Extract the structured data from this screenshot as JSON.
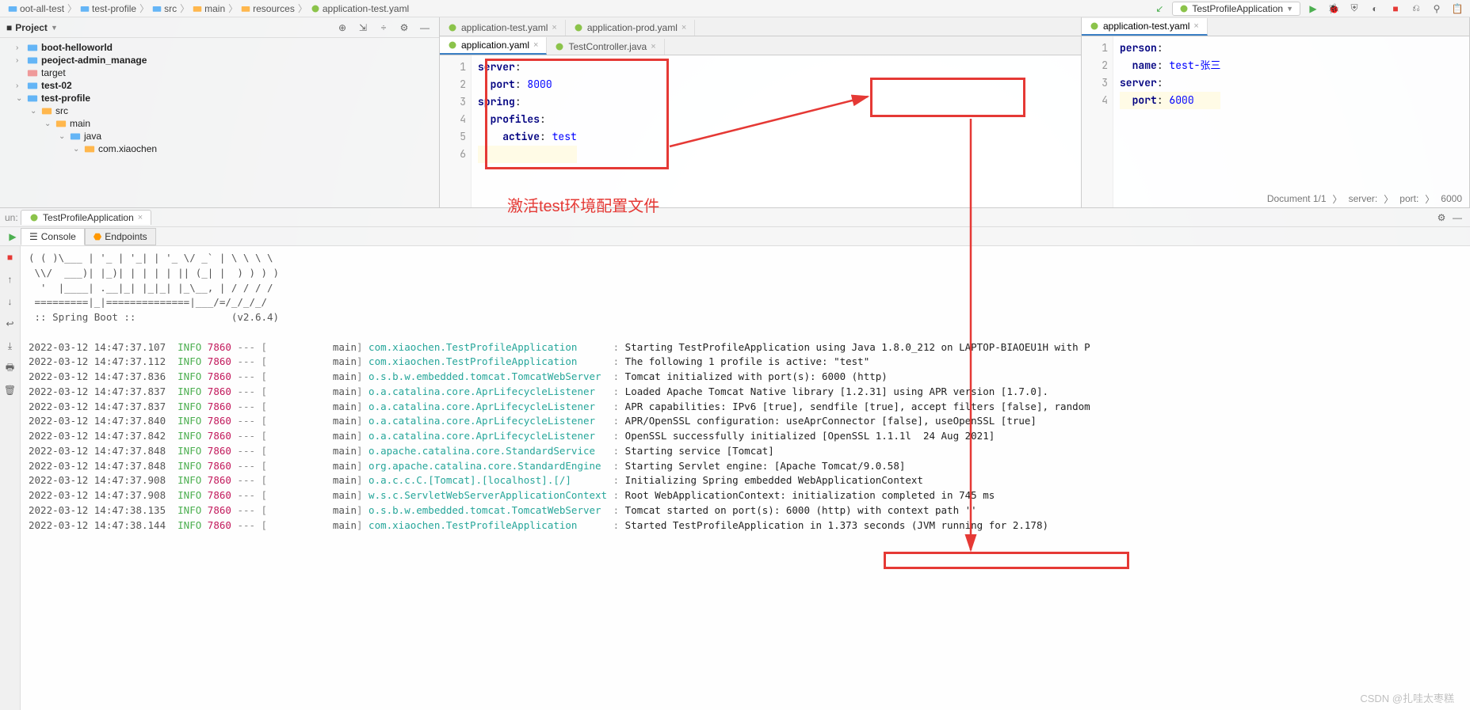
{
  "breadcrumb": [
    "oot-all-test",
    "test-profile",
    "src",
    "main",
    "resources",
    "application-test.yaml"
  ],
  "run_config": "TestProfileApplication",
  "project_panel_title": "Project",
  "tree": {
    "n0": "boot-helloworld",
    "n1": "peoject-admin_manage",
    "n2": "target",
    "n3": "test-02",
    "n4": "test-profile",
    "n5": "src",
    "n6": "main",
    "n7": "java",
    "n8": "com.xiaochen"
  },
  "tabs_left_top": [
    {
      "label": "application-test.yaml",
      "active": false
    },
    {
      "label": "application-prod.yaml",
      "active": false
    }
  ],
  "tabs_left_bottom": [
    {
      "label": "application.yaml",
      "active": true
    },
    {
      "label": "TestController.java",
      "active": false
    }
  ],
  "tabs_right_top": [
    {
      "label": "application-test.yaml",
      "active": true
    }
  ],
  "editor_left": {
    "lines": [
      {
        "n": "1",
        "kw": "server",
        "sep": ":",
        "val": ""
      },
      {
        "n": "2",
        "kw": "  port",
        "sep": ": ",
        "val": "8000"
      },
      {
        "n": "3",
        "kw": "spring",
        "sep": ":",
        "val": ""
      },
      {
        "n": "4",
        "kw": "  profiles",
        "sep": ":",
        "val": ""
      },
      {
        "n": "5",
        "kw": "    active",
        "sep": ": ",
        "val": "test"
      },
      {
        "n": "6",
        "kw": "",
        "sep": "",
        "val": ""
      }
    ]
  },
  "editor_right": {
    "lines": [
      {
        "n": "1",
        "kw": "person",
        "sep": ":",
        "val": ""
      },
      {
        "n": "2",
        "kw": "  name",
        "sep": ": ",
        "val": "test-张三"
      },
      {
        "n": "3",
        "kw": "server",
        "sep": ":",
        "val": ""
      },
      {
        "n": "4",
        "kw": "  port",
        "sep": ": ",
        "val": "6000"
      }
    ]
  },
  "annotation": "激活test环境配置文件",
  "status_right": [
    "Document 1/1",
    "server:",
    "port:",
    "6000"
  ],
  "run_label_prefix": "un:",
  "run_tab": "TestProfileApplication",
  "sub_tabs": [
    "Console",
    "Endpoints"
  ],
  "banner": [
    "( ( )\\___ | '_ | '_| | '_ \\/ _` | \\ \\ \\ \\",
    " \\\\/  ___)| |_)| | | | | || (_| |  ) ) ) )",
    "  '  |____| .__|_| |_|_| |_\\__, | / / / /",
    " =========|_|==============|___/=/_/_/_/",
    " :: Spring Boot ::                (v2.6.4)"
  ],
  "logs": [
    {
      "ts": "2022-03-12 14:47:37.107",
      "lvl": "INFO",
      "pid": "7860",
      "thread": "main",
      "logger": "com.xiaochen.TestProfileApplication",
      "msg": "Starting TestProfileApplication using Java 1.8.0_212 on LAPTOP-BIAOEU1H with P"
    },
    {
      "ts": "2022-03-12 14:47:37.112",
      "lvl": "INFO",
      "pid": "7860",
      "thread": "main",
      "logger": "com.xiaochen.TestProfileApplication",
      "msg": "The following 1 profile is active: \"test\""
    },
    {
      "ts": "2022-03-12 14:47:37.836",
      "lvl": "INFO",
      "pid": "7860",
      "thread": "main",
      "logger": "o.s.b.w.embedded.tomcat.TomcatWebServer",
      "msg": "Tomcat initialized with port(s): 6000 (http)"
    },
    {
      "ts": "2022-03-12 14:47:37.837",
      "lvl": "INFO",
      "pid": "7860",
      "thread": "main",
      "logger": "o.a.catalina.core.AprLifecycleListener",
      "msg": "Loaded Apache Tomcat Native library [1.2.31] using APR version [1.7.0]."
    },
    {
      "ts": "2022-03-12 14:47:37.837",
      "lvl": "INFO",
      "pid": "7860",
      "thread": "main",
      "logger": "o.a.catalina.core.AprLifecycleListener",
      "msg": "APR capabilities: IPv6 [true], sendfile [true], accept filters [false], random"
    },
    {
      "ts": "2022-03-12 14:47:37.840",
      "lvl": "INFO",
      "pid": "7860",
      "thread": "main",
      "logger": "o.a.catalina.core.AprLifecycleListener",
      "msg": "APR/OpenSSL configuration: useAprConnector [false], useOpenSSL [true]"
    },
    {
      "ts": "2022-03-12 14:47:37.842",
      "lvl": "INFO",
      "pid": "7860",
      "thread": "main",
      "logger": "o.a.catalina.core.AprLifecycleListener",
      "msg": "OpenSSL successfully initialized [OpenSSL 1.1.1l  24 Aug 2021]"
    },
    {
      "ts": "2022-03-12 14:47:37.848",
      "lvl": "INFO",
      "pid": "7860",
      "thread": "main",
      "logger": "o.apache.catalina.core.StandardService",
      "msg": "Starting service [Tomcat]"
    },
    {
      "ts": "2022-03-12 14:47:37.848",
      "lvl": "INFO",
      "pid": "7860",
      "thread": "main",
      "logger": "org.apache.catalina.core.StandardEngine",
      "msg": "Starting Servlet engine: [Apache Tomcat/9.0.58]"
    },
    {
      "ts": "2022-03-12 14:47:37.908",
      "lvl": "INFO",
      "pid": "7860",
      "thread": "main",
      "logger": "o.a.c.c.C.[Tomcat].[localhost].[/]",
      "msg": "Initializing Spring embedded WebApplicationContext"
    },
    {
      "ts": "2022-03-12 14:47:37.908",
      "lvl": "INFO",
      "pid": "7860",
      "thread": "main",
      "logger": "w.s.c.ServletWebServerApplicationContext",
      "msg": "Root WebApplicationContext: initialization completed in 745 ms"
    },
    {
      "ts": "2022-03-12 14:47:38.135",
      "lvl": "INFO",
      "pid": "7860",
      "thread": "main",
      "logger": "o.s.b.w.embedded.tomcat.TomcatWebServer",
      "msg": "Tomcat started on port(s): 6000 (http) with context path ''"
    },
    {
      "ts": "2022-03-12 14:47:38.144",
      "lvl": "INFO",
      "pid": "7860",
      "thread": "main",
      "logger": "com.xiaochen.TestProfileApplication",
      "msg": "Started TestProfileApplication in 1.373 seconds (JVM running for 2.178)"
    }
  ],
  "watermark": "CSDN @扎哇太枣糕"
}
